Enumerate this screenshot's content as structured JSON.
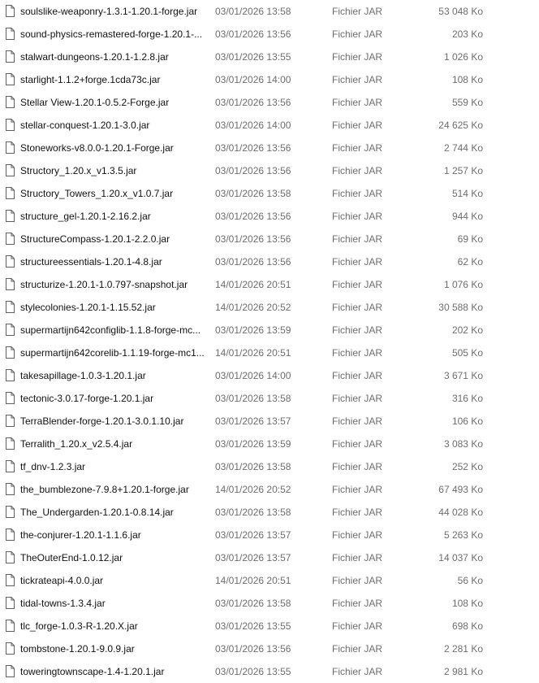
{
  "file_list": {
    "rows": [
      {
        "name": "soulslike-weaponry-1.3.1-1.20.1-forge.jar",
        "date": "03/01/2026 13:58",
        "type": "Fichier JAR",
        "size": "53 048 Ko",
        "icon": "file-icon"
      },
      {
        "name": "sound-physics-remastered-forge-1.20.1-...",
        "date": "03/01/2026 13:56",
        "type": "Fichier JAR",
        "size": "203 Ko",
        "icon": "file-icon"
      },
      {
        "name": "stalwart-dungeons-1.20.1-1.2.8.jar",
        "date": "03/01/2026 13:55",
        "type": "Fichier JAR",
        "size": "1 026 Ko",
        "icon": "file-icon"
      },
      {
        "name": "starlight-1.1.2+forge.1cda73c.jar",
        "date": "03/01/2026 14:00",
        "type": "Fichier JAR",
        "size": "108 Ko",
        "icon": "file-icon"
      },
      {
        "name": "Stellar View-1.20.1-0.5.2-Forge.jar",
        "date": "03/01/2026 13:56",
        "type": "Fichier JAR",
        "size": "559 Ko",
        "icon": "file-icon"
      },
      {
        "name": "stellar-conquest-1.20.1-3.0.jar",
        "date": "03/01/2026 14:00",
        "type": "Fichier JAR",
        "size": "24 625 Ko",
        "icon": "file-icon"
      },
      {
        "name": "Stoneworks-v8.0.0-1.20.1-Forge.jar",
        "date": "03/01/2026 13:56",
        "type": "Fichier JAR",
        "size": "2 744 Ko",
        "icon": "file-icon"
      },
      {
        "name": "Structory_1.20.x_v1.3.5.jar",
        "date": "03/01/2026 13:56",
        "type": "Fichier JAR",
        "size": "1 257 Ko",
        "icon": "file-icon"
      },
      {
        "name": "Structory_Towers_1.20.x_v1.0.7.jar",
        "date": "03/01/2026 13:58",
        "type": "Fichier JAR",
        "size": "514 Ko",
        "icon": "file-icon"
      },
      {
        "name": "structure_gel-1.20.1-2.16.2.jar",
        "date": "03/01/2026 13:56",
        "type": "Fichier JAR",
        "size": "944 Ko",
        "icon": "file-icon"
      },
      {
        "name": "StructureCompass-1.20.1-2.2.0.jar",
        "date": "03/01/2026 13:56",
        "type": "Fichier JAR",
        "size": "69 Ko",
        "icon": "file-icon"
      },
      {
        "name": "structureessentials-1.20.1-4.8.jar",
        "date": "03/01/2026 13:56",
        "type": "Fichier JAR",
        "size": "62 Ko",
        "icon": "file-icon"
      },
      {
        "name": "structurize-1.20.1-1.0.797-snapshot.jar",
        "date": "14/01/2026 20:51",
        "type": "Fichier JAR",
        "size": "1 076 Ko",
        "icon": "file-icon"
      },
      {
        "name": "stylecolonies-1.20.1-1.15.52.jar",
        "date": "14/01/2026 20:52",
        "type": "Fichier JAR",
        "size": "30 588 Ko",
        "icon": "file-icon"
      },
      {
        "name": "supermartijn642configlib-1.1.8-forge-mc...",
        "date": "03/01/2026 13:59",
        "type": "Fichier JAR",
        "size": "202 Ko",
        "icon": "file-icon"
      },
      {
        "name": "supermartijn642corelib-1.1.19-forge-mc1...",
        "date": "14/01/2026 20:51",
        "type": "Fichier JAR",
        "size": "505 Ko",
        "icon": "file-icon"
      },
      {
        "name": "takesapillage-1.0.3-1.20.1.jar",
        "date": "03/01/2026 14:00",
        "type": "Fichier JAR",
        "size": "3 671 Ko",
        "icon": "file-icon"
      },
      {
        "name": "tectonic-3.0.17-forge-1.20.1.jar",
        "date": "03/01/2026 13:58",
        "type": "Fichier JAR",
        "size": "316 Ko",
        "icon": "file-icon"
      },
      {
        "name": "TerraBlender-forge-1.20.1-3.0.1.10.jar",
        "date": "03/01/2026 13:57",
        "type": "Fichier JAR",
        "size": "106 Ko",
        "icon": "file-icon"
      },
      {
        "name": "Terralith_1.20.x_v2.5.4.jar",
        "date": "03/01/2026 13:59",
        "type": "Fichier JAR",
        "size": "3 083 Ko",
        "icon": "file-icon"
      },
      {
        "name": "tf_dnv-1.2.3.jar",
        "date": "03/01/2026 13:58",
        "type": "Fichier JAR",
        "size": "252 Ko",
        "icon": "file-icon"
      },
      {
        "name": "the_bumblezone-7.9.8+1.20.1-forge.jar",
        "date": "14/01/2026 20:52",
        "type": "Fichier JAR",
        "size": "67 493 Ko",
        "icon": "file-icon"
      },
      {
        "name": "The_Undergarden-1.20.1-0.8.14.jar",
        "date": "03/01/2026 13:58",
        "type": "Fichier JAR",
        "size": "44 028 Ko",
        "icon": "file-icon"
      },
      {
        "name": "the-conjurer-1.20.1-1.1.6.jar",
        "date": "03/01/2026 13:57",
        "type": "Fichier JAR",
        "size": "5 263 Ko",
        "icon": "file-icon"
      },
      {
        "name": "TheOuterEnd-1.0.12.jar",
        "date": "03/01/2026 13:57",
        "type": "Fichier JAR",
        "size": "14 037 Ko",
        "icon": "file-icon"
      },
      {
        "name": "tickrateapi-4.0.0.jar",
        "date": "14/01/2026 20:51",
        "type": "Fichier JAR",
        "size": "56 Ko",
        "icon": "file-icon"
      },
      {
        "name": "tidal-towns-1.3.4.jar",
        "date": "03/01/2026 13:58",
        "type": "Fichier JAR",
        "size": "108 Ko",
        "icon": "file-icon"
      },
      {
        "name": "tlc_forge-1.0.3-R-1.20.X.jar",
        "date": "03/01/2026 13:55",
        "type": "Fichier JAR",
        "size": "698 Ko",
        "icon": "file-icon"
      },
      {
        "name": "tombstone-1.20.1-9.0.9.jar",
        "date": "03/01/2026 13:56",
        "type": "Fichier JAR",
        "size": "2 281 Ko",
        "icon": "file-icon"
      },
      {
        "name": "toweringtownscape-1.4-1.20.1.jar",
        "date": "03/01/2026 13:55",
        "type": "Fichier JAR",
        "size": "2 981 Ko",
        "icon": "file-icon"
      }
    ]
  },
  "colors": {
    "background": "#ffffff",
    "name_text": "#111111",
    "meta_text": "#6d6d6d",
    "icon_stroke": "#5f5f5f"
  }
}
